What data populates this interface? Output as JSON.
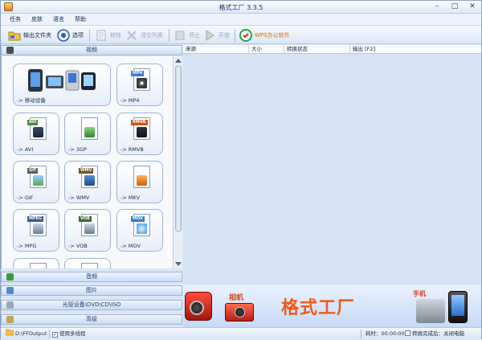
{
  "window": {
    "title": "格式工厂 3.3.5"
  },
  "menu": [
    "任务",
    "皮肤",
    "语言",
    "帮助"
  ],
  "toolbar": {
    "output_folder": "输出文件夹",
    "options": "选项",
    "remove": "移除",
    "clear_list": "清空列表",
    "stop": "停止",
    "start": "开始",
    "wps": "WPS办公软件"
  },
  "categories": {
    "video": "视频",
    "audio": "音频",
    "image": "图片",
    "optical": "光驱设备\\DVD\\CD\\ISO",
    "advanced": "高级"
  },
  "video_tiles": [
    {
      "label": "-> 移动设备",
      "tag": ""
    },
    {
      "label": "-> MP4",
      "tag": "MP4"
    },
    {
      "label": "-> AVI",
      "tag": "AVI"
    },
    {
      "label": "-> 3GP",
      "tag": ""
    },
    {
      "label": "-> RMVB",
      "tag": "RMVB"
    },
    {
      "label": "-> GIF",
      "tag": "GIF"
    },
    {
      "label": "-> WMV",
      "tag": "WMV"
    },
    {
      "label": "-> MKV",
      "tag": ""
    },
    {
      "label": "-> MPG",
      "tag": "MPEG"
    },
    {
      "label": "-> VOB",
      "tag": "VOB"
    },
    {
      "label": "-> MOV",
      "tag": "MOV"
    }
  ],
  "table": {
    "columns": [
      "来源",
      "大小",
      "转换状态",
      "输出 [F2]"
    ]
  },
  "banner": {
    "title": "格式工厂",
    "camera_label": "相机",
    "phone_label": "手机"
  },
  "status": {
    "output_path": "D:\\FFOutput",
    "multithread": "使用多线程",
    "elapsed": "耗时：00:00:00",
    "after_convert": "转换完成后：关闭电脑"
  }
}
